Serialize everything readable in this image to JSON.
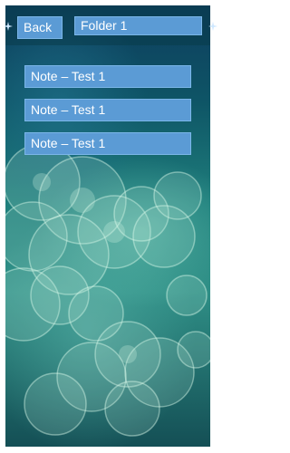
{
  "header": {
    "back_label": "Back",
    "title": "Folder 1"
  },
  "notes": [
    {
      "label": "Note – Test 1"
    },
    {
      "label": "Note – Test 1"
    },
    {
      "label": "Note – Test 1"
    }
  ],
  "theme": {
    "button_color": "#5b9bd5",
    "text_color": "#ffffff"
  }
}
